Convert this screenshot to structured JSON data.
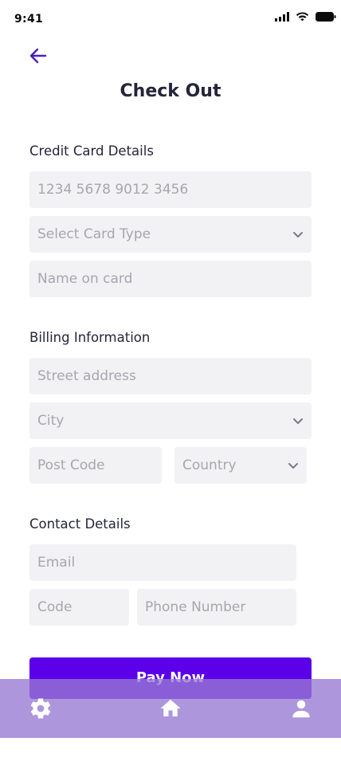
{
  "status_bar": {
    "time": "9:41",
    "icons": [
      "cellular-signal-icon",
      "wifi-icon",
      "battery-icon"
    ]
  },
  "header": {
    "back_icon": "arrow-left-icon",
    "title": "Check Out"
  },
  "credit_card": {
    "label": "Credit Card Details",
    "card_number_placeholder": "1234 5678 9012 3456",
    "card_type_placeholder": "Select Card Type",
    "name_placeholder": "Name on card"
  },
  "billing": {
    "label": "Billing Information",
    "street_placeholder": "Street address",
    "city_placeholder": "City",
    "post_code_placeholder": "Post Code",
    "country_placeholder": "Country"
  },
  "contact": {
    "label": "Contact Details",
    "email_placeholder": "Email",
    "code_placeholder": "Code",
    "phone_placeholder": "Phone Number"
  },
  "actions": {
    "pay_label": "Pay Now"
  },
  "bottom_nav": {
    "items": [
      "gear-icon",
      "home-icon",
      "user-icon"
    ]
  },
  "colors": {
    "accent": "#5b00e8",
    "back_arrow": "#4a1fb8",
    "field_bg": "#f2f2f5",
    "placeholder": "#a6a6ae",
    "nav_bg": "#a98fdb"
  }
}
